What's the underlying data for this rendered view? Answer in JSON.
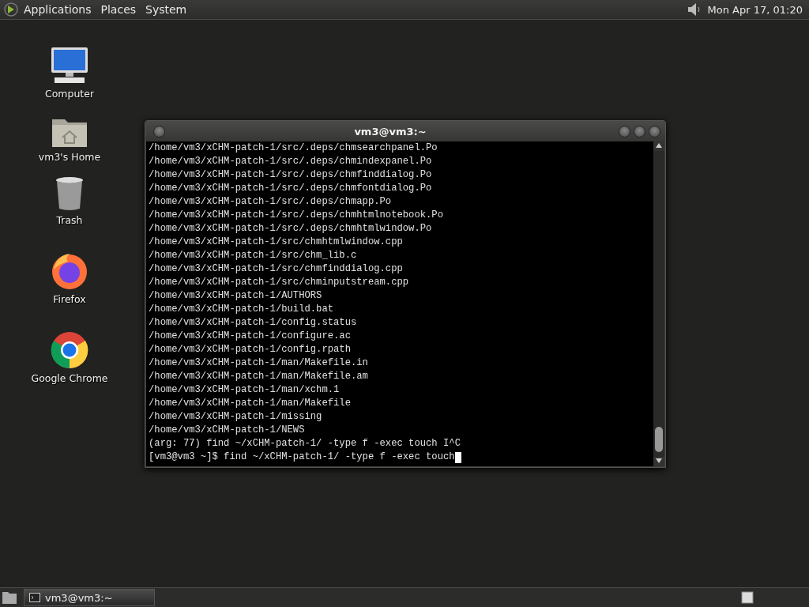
{
  "top_panel": {
    "menus": [
      "Applications",
      "Places",
      "System"
    ],
    "clock": "Mon Apr 17, 01:20"
  },
  "desktop_icons": [
    {
      "kind": "computer",
      "label": "Computer"
    },
    {
      "kind": "home",
      "label": "vm3's Home"
    },
    {
      "kind": "trash",
      "label": "Trash"
    },
    {
      "kind": "firefox",
      "label": "Firefox"
    },
    {
      "kind": "chrome",
      "label": "Google Chrome"
    }
  ],
  "terminal": {
    "title": "vm3@vm3:~",
    "lines": [
      "/home/vm3/xCHM-patch-1/src/.deps/chmsearchpanel.Po",
      "/home/vm3/xCHM-patch-1/src/.deps/chmindexpanel.Po",
      "/home/vm3/xCHM-patch-1/src/.deps/chmfinddialog.Po",
      "/home/vm3/xCHM-patch-1/src/.deps/chmfontdialog.Po",
      "/home/vm3/xCHM-patch-1/src/.deps/chmapp.Po",
      "/home/vm3/xCHM-patch-1/src/.deps/chmhtmlnotebook.Po",
      "/home/vm3/xCHM-patch-1/src/.deps/chmhtmlwindow.Po",
      "/home/vm3/xCHM-patch-1/src/chmhtmlwindow.cpp",
      "/home/vm3/xCHM-patch-1/src/chm_lib.c",
      "/home/vm3/xCHM-patch-1/src/chmfinddialog.cpp",
      "/home/vm3/xCHM-patch-1/src/chminputstream.cpp",
      "/home/vm3/xCHM-patch-1/AUTHORS",
      "/home/vm3/xCHM-patch-1/build.bat",
      "/home/vm3/xCHM-patch-1/config.status",
      "/home/vm3/xCHM-patch-1/configure.ac",
      "/home/vm3/xCHM-patch-1/config.rpath",
      "/home/vm3/xCHM-patch-1/man/Makefile.in",
      "/home/vm3/xCHM-patch-1/man/Makefile.am",
      "/home/vm3/xCHM-patch-1/man/xchm.1",
      "/home/vm3/xCHM-patch-1/man/Makefile",
      "/home/vm3/xCHM-patch-1/missing",
      "/home/vm3/xCHM-patch-1/NEWS",
      "(arg: 77) find ~/xCHM-patch-1/ -type f -exec touch I^C"
    ],
    "prompt": "[vm3@vm3 ~]$ find ~/xCHM-patch-1/ -type f -exec touch"
  },
  "taskbar": {
    "tasks": [
      {
        "label": "vm3@vm3:~",
        "selected": true
      }
    ]
  }
}
